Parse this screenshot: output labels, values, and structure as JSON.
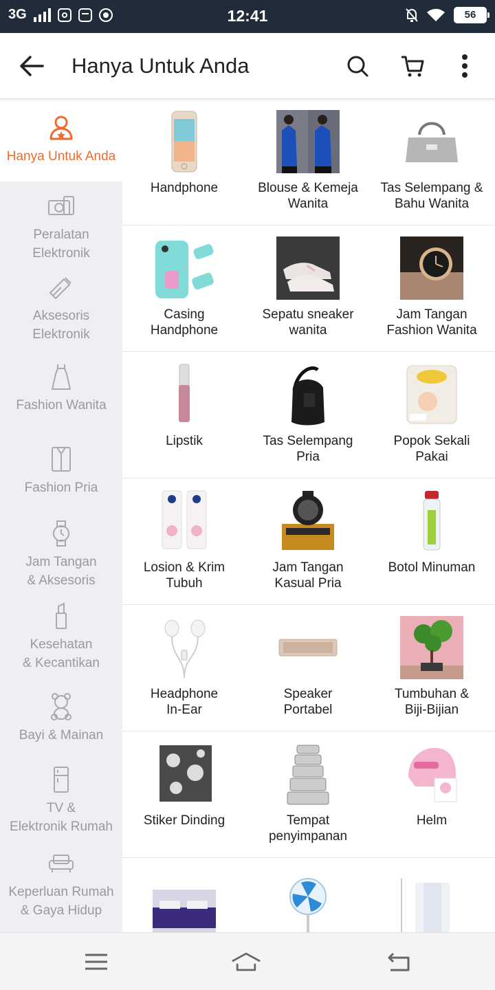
{
  "status_bar": {
    "network": "3G",
    "time": "12:41",
    "battery": "56"
  },
  "app_bar": {
    "title": "Hanya Untuk Anda"
  },
  "colors": {
    "accent": "#ee6a2c",
    "status_bar_bg": "#202c3a",
    "sidebar_bg": "#eeeff2"
  },
  "sidebar": {
    "items": [
      {
        "label": "Hanya Untuk Anda",
        "icon": "user-star-icon",
        "active": true
      },
      {
        "label": "Peralatan\nElektronik",
        "icon": "camera-icon"
      },
      {
        "label": "Aksesoris\nElektronik",
        "icon": "usb-icon"
      },
      {
        "label": "Fashion Wanita",
        "icon": "dress-icon"
      },
      {
        "label": "Fashion Pria",
        "icon": "shirt-icon"
      },
      {
        "label": "Jam Tangan\n& Aksesoris",
        "icon": "watch-icon"
      },
      {
        "label": "Kesehatan\n& Kecantikan",
        "icon": "lipstick-icon"
      },
      {
        "label": "Bayi & Mainan",
        "icon": "teddy-bear-icon"
      },
      {
        "label": "TV &\nElektronik Rumah",
        "icon": "fridge-icon"
      },
      {
        "label": "Keperluan Rumah\n& Gaya Hidup",
        "icon": "sofa-icon"
      }
    ]
  },
  "categories": [
    {
      "label": "Handphone",
      "icon": "phone-image"
    },
    {
      "label": "Blouse & Kemeja\nWanita",
      "icon": "blouse-image"
    },
    {
      "label": "Tas Selempang &\nBahu Wanita",
      "icon": "handbag-image"
    },
    {
      "label": "Casing\nHandphone",
      "icon": "phone-case-image"
    },
    {
      "label": "Sepatu sneaker\nwanita",
      "icon": "sneaker-image"
    },
    {
      "label": "Jam Tangan\nFashion Wanita",
      "icon": "ladies-watch-image"
    },
    {
      "label": "Lipstik",
      "icon": "lipstick-image"
    },
    {
      "label": "Tas Selempang\nPria",
      "icon": "sling-bag-image"
    },
    {
      "label": "Popok Sekali\nPakai",
      "icon": "diaper-image"
    },
    {
      "label": "Losion & Krim\nTubuh",
      "icon": "lotion-image"
    },
    {
      "label": "Jam Tangan\nKasual Pria",
      "icon": "mens-watch-image"
    },
    {
      "label": "Botol Minuman",
      "icon": "bottle-image"
    },
    {
      "label": "Headphone\nIn-Ear",
      "icon": "earphone-image"
    },
    {
      "label": "Speaker\nPortabel",
      "icon": "speaker-image"
    },
    {
      "label": "Tumbuhan &\nBiji-Bijian",
      "icon": "bonsai-image"
    },
    {
      "label": "Stiker Dinding",
      "icon": "wall-sticker-image"
    },
    {
      "label": "Tempat\npenyimpanan",
      "icon": "containers-image"
    },
    {
      "label": "Helm",
      "icon": "helmet-image"
    },
    {
      "label": "",
      "icon": "bedsheet-image"
    },
    {
      "label": "",
      "icon": "fan-image"
    },
    {
      "label": "",
      "icon": "curtain-image"
    }
  ]
}
